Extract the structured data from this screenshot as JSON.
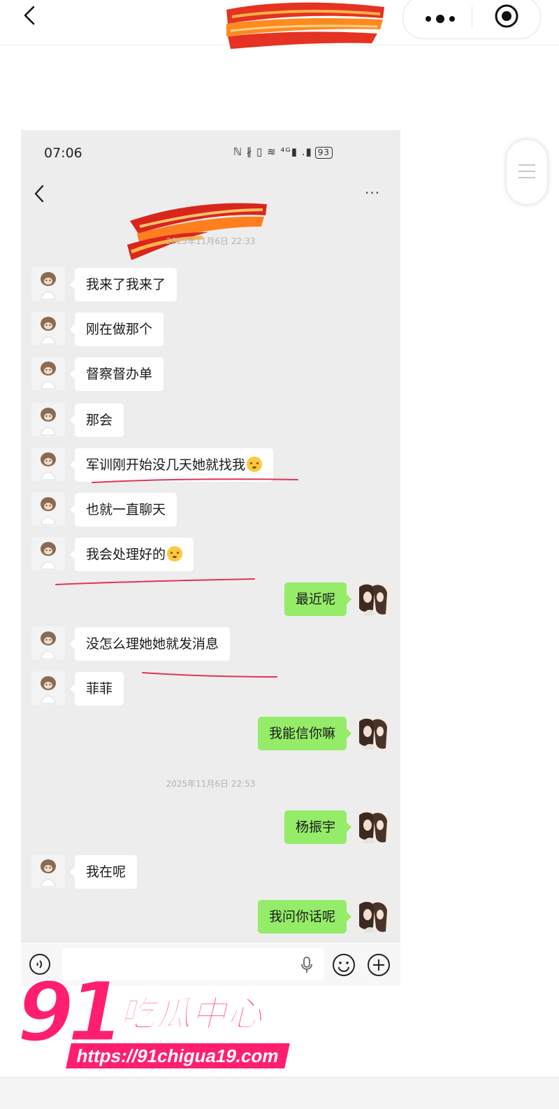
{
  "outer": {
    "back_icon": "chevron-left-icon",
    "more_icon": "more-dots-icon",
    "close_icon": "target-circle-icon",
    "side_icon": "menu-lines-icon"
  },
  "phone": {
    "time": "07:06",
    "status_icons_text": "ℕ ∦ ▯ ≋ ⁴ᴳ▮ .▮",
    "battery": "93",
    "header_back_icon": "chevron-left-icon",
    "header_more": "···"
  },
  "timestamps": [
    "2025年11月6日 22:33",
    "2025年11月6日 22:53"
  ],
  "messages": [
    {
      "side": "in",
      "text": "我来了我来了"
    },
    {
      "side": "in",
      "text": "刚在做那个"
    },
    {
      "side": "in",
      "text": "督察督办单"
    },
    {
      "side": "in",
      "text": "那会"
    },
    {
      "side": "in",
      "text": "军训刚开始没几天她就找我",
      "emoji": "upside-down-face"
    },
    {
      "side": "in",
      "text": "也就一直聊天"
    },
    {
      "side": "in",
      "text": "我会处理好的",
      "emoji": "upside-down-face"
    },
    {
      "side": "out",
      "text": "最近呢"
    },
    {
      "side": "in",
      "text": "没怎么理她她就发消息"
    },
    {
      "side": "in",
      "text": "菲菲"
    },
    {
      "side": "out",
      "text": "我能信你嘛"
    },
    {
      "side": "out",
      "text": "杨振宇"
    },
    {
      "side": "in",
      "text": "我在呢"
    },
    {
      "side": "out",
      "text": "我问你话呢"
    }
  ],
  "input_bar": {
    "voice_icon": "voice-icon",
    "mic_icon": "mic-icon",
    "emoji_icon": "emoji-icon",
    "plus_icon": "plus-icon"
  },
  "watermark": {
    "number": "91",
    "name": "吃瓜中心",
    "url": "https://91chigua19.com"
  },
  "colors": {
    "bubble_in": "#ffffff",
    "bubble_out": "#95ec69",
    "chat_bg": "#ededed",
    "watermark": "#ff1f6e",
    "annotation_line": "#e0335a"
  }
}
